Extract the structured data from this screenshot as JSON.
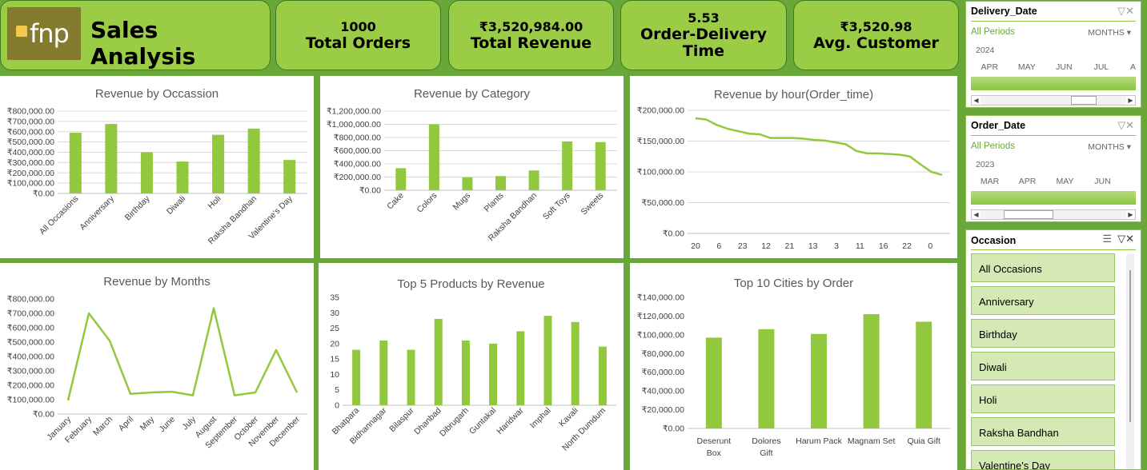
{
  "header": {
    "logo_text": "fnp",
    "title": "Sales Analysis",
    "kpis": [
      {
        "value": "1000",
        "label": "Total Orders"
      },
      {
        "value": "₹3,520,984.00",
        "label": "Total Revenue"
      },
      {
        "value": "5.53",
        "label": "Order-Delivery Time"
      },
      {
        "value": "₹3,520.98",
        "label": "Avg. Customer"
      }
    ]
  },
  "colors": {
    "bar": "#92c83e",
    "background": "#6aa73a",
    "kpi": "#9bcc45",
    "slicer_item": "#d5e9b4"
  },
  "slicers": {
    "delivery_date": {
      "title": "Delivery_Date",
      "all_label": "All Periods",
      "mode": "MONTHS",
      "year": "2024",
      "months": [
        "APR",
        "MAY",
        "JUN",
        "JUL",
        "A"
      ]
    },
    "order_date": {
      "title": "Order_Date",
      "all_label": "All Periods",
      "mode": "MONTHS",
      "year": "2023",
      "months": [
        "MAR",
        "APR",
        "MAY",
        "JUN"
      ]
    },
    "occasion": {
      "title": "Occasion",
      "items": [
        "All Occasions",
        "Anniversary",
        "Birthday",
        "Diwali",
        "Holi",
        "Raksha Bandhan",
        "Valentine's Day"
      ]
    }
  },
  "chart_data": [
    {
      "id": "occasion",
      "type": "bar",
      "title": "Revenue by Occassion",
      "categories": [
        "All Occasions",
        "Anniversary",
        "Birthday",
        "Diwali",
        "Holi",
        "Raksha Bandhan",
        "Valentine's Day"
      ],
      "values": [
        590000,
        675000,
        400000,
        310000,
        570000,
        630000,
        325000
      ],
      "ylim": [
        0,
        800000
      ],
      "yticks": [
        0,
        100000,
        200000,
        300000,
        400000,
        500000,
        600000,
        700000,
        800000
      ],
      "ytick_labels": [
        "₹0.00",
        "₹100,000.00",
        "₹200,000.00",
        "₹300,000.00",
        "₹400,000.00",
        "₹500,000.00",
        "₹600,000.00",
        "₹700,000.00",
        "₹800,000.00"
      ],
      "grid": true,
      "xlabel_rotation": -45
    },
    {
      "id": "category",
      "type": "bar",
      "title": "Revenue by Category",
      "categories": [
        "Cake",
        "Colors",
        "Mugs",
        "Plants",
        "Raksha Bandhan",
        "Soft Toys",
        "Sweets"
      ],
      "values": [
        335000,
        1000000,
        195000,
        215000,
        300000,
        740000,
        730000
      ],
      "ylim": [
        0,
        1200000
      ],
      "yticks": [
        0,
        200000,
        400000,
        600000,
        800000,
        1000000,
        1200000
      ],
      "ytick_labels": [
        "₹0.00",
        "₹200,000.00",
        "₹400,000.00",
        "₹600,000.00",
        "₹800,000.00",
        "₹1,000,000.00",
        "₹1,200,000.00"
      ],
      "grid": true,
      "xlabel_rotation": -45
    },
    {
      "id": "hour",
      "type": "line",
      "title": "Revenue by hour(Order_time)",
      "x": [
        "20",
        "",
        "6",
        "",
        "23",
        "",
        "12",
        "",
        "21",
        "",
        "",
        "13",
        "",
        "3",
        "",
        "11",
        "",
        "16",
        "",
        "22",
        "",
        "0",
        ""
      ],
      "xtick_labels": [
        "20",
        "6",
        "23",
        "12",
        "21",
        "13",
        "3",
        "11",
        "16",
        "22",
        "0"
      ],
      "values": [
        187000,
        185000,
        176000,
        170000,
        166000,
        162000,
        161000,
        155000,
        155000,
        155000,
        154000,
        152000,
        151000,
        148000,
        145000,
        134000,
        130000,
        130000,
        129000,
        128000,
        125000,
        112000,
        100000,
        95000
      ],
      "ylim": [
        0,
        200000
      ],
      "yticks": [
        0,
        50000,
        100000,
        150000,
        200000
      ],
      "ytick_labels": [
        "₹0.00",
        "₹50,000.00",
        "₹100,000.00",
        "₹150,000.00",
        "₹200,000.00"
      ],
      "grid": true
    },
    {
      "id": "months",
      "type": "line",
      "title": "Revenue by Months",
      "categories": [
        "January",
        "February",
        "March",
        "April",
        "May",
        "June",
        "July",
        "August",
        "September",
        "October",
        "November",
        "December"
      ],
      "values": [
        95000,
        700000,
        510000,
        140000,
        150000,
        155000,
        130000,
        735000,
        130000,
        150000,
        445000,
        150000
      ],
      "ylim": [
        0,
        800000
      ],
      "yticks": [
        0,
        100000,
        200000,
        300000,
        400000,
        500000,
        600000,
        700000,
        800000
      ],
      "ytick_labels": [
        "₹0.00",
        "₹100,000.00",
        "₹200,000.00",
        "₹300,000.00",
        "₹400,000.00",
        "₹500,000.00",
        "₹600,000.00",
        "₹700,000.00",
        "₹800,000.00"
      ],
      "grid": false,
      "xlabel_rotation": -45
    },
    {
      "id": "products",
      "type": "bar",
      "title": "Top 5 Products by Revenue",
      "categories": [
        "Bhatpara",
        "Bidhannagar",
        "Bilaspur",
        "Dhanbad",
        "Dibrugarh",
        "Guntakal",
        "Haridwar",
        "Imphal",
        "Kavali",
        "North Dumdum"
      ],
      "values": [
        18,
        21,
        18,
        28,
        21,
        20,
        24,
        29,
        27,
        19
      ],
      "ylim": [
        0,
        35
      ],
      "yticks": [
        0,
        5,
        10,
        15,
        20,
        25,
        30,
        35
      ],
      "ytick_labels": [
        "0",
        "5",
        "10",
        "15",
        "20",
        "25",
        "30",
        "35"
      ],
      "grid": false,
      "xlabel_rotation": -45
    },
    {
      "id": "cities",
      "type": "bar",
      "title": "Top 10 Cities by Order",
      "categories": [
        "Deserunt Box",
        "Dolores Gift",
        "Harum Pack",
        "Magnam Set",
        "Quia Gift"
      ],
      "values": [
        97000,
        106000,
        101000,
        122000,
        114000
      ],
      "ylim": [
        0,
        140000
      ],
      "yticks": [
        0,
        20000,
        40000,
        60000,
        80000,
        100000,
        120000,
        140000
      ],
      "ytick_labels": [
        "₹0.00",
        "₹20,000.00",
        "₹40,000.00",
        "₹60,000.00",
        "₹80,000.00",
        "₹100,000.00",
        "₹120,000.00",
        "₹140,000.00"
      ],
      "grid": false,
      "xlabel_rotation": 0
    }
  ]
}
